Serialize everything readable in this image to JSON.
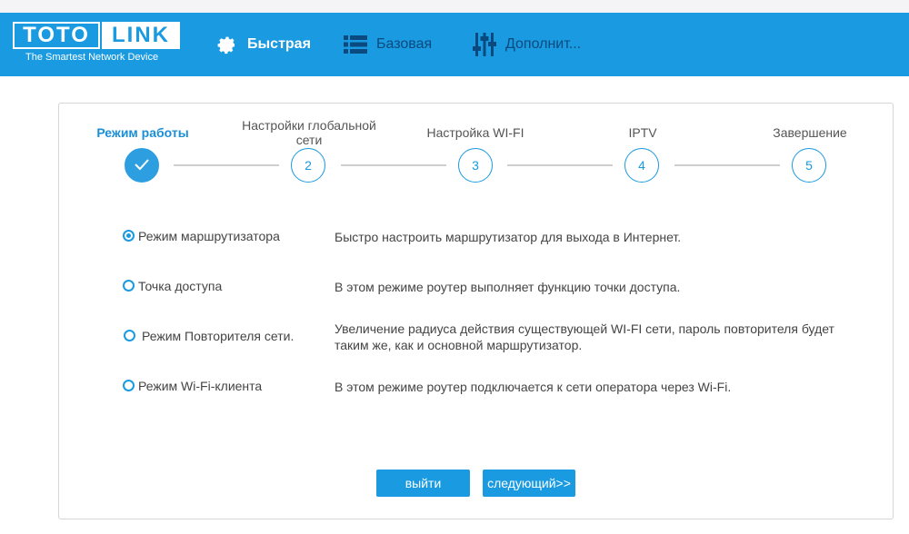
{
  "header": {
    "logo_left": "TOTO",
    "logo_right": "LINK",
    "tagline": "The Smartest Network Device",
    "nav": [
      {
        "label": "Быстрая",
        "icon": "gear-icon"
      },
      {
        "label": "Базовая",
        "icon": "list-icon"
      },
      {
        "label": "Дополнит...",
        "icon": "sliders-icon"
      }
    ]
  },
  "wizard": {
    "steps": [
      {
        "label": "Режим работы",
        "number": "",
        "state": "done"
      },
      {
        "label": "Настройки глобальной сети",
        "number": "2",
        "state": "pending"
      },
      {
        "label": "Настройка WI-FI",
        "number": "3",
        "state": "pending"
      },
      {
        "label": "IPTV",
        "number": "4",
        "state": "pending"
      },
      {
        "label": "Завершение",
        "number": "5",
        "state": "pending"
      }
    ]
  },
  "modes": [
    {
      "name": "Режим маршрутизатора",
      "description": "Быстро настроить маршрутизатор для выхода в Интернет.",
      "selected": true
    },
    {
      "name": "Точка доступа",
      "description": "В этом режиме роутер выполняет функцию точки доступа.",
      "selected": false
    },
    {
      "name": "Режим Повторителя сети.",
      "description": "Увеличение радиуса действия существующей WI-FI сети, пароль повторителя будет таким же, как и основной маршрутизатор.",
      "selected": false
    },
    {
      "name": "Режим Wi-Fi-клиента",
      "description": "В этом режиме роутер подключается к сети оператора через Wi-Fi.",
      "selected": false
    }
  ],
  "buttons": {
    "exit_label": "выйти",
    "next_label": "следующий>>"
  },
  "colors": {
    "header_bg": "#1a9ae0",
    "accent": "#1a9ae0",
    "inactive_nav": "#0b4a7e"
  }
}
